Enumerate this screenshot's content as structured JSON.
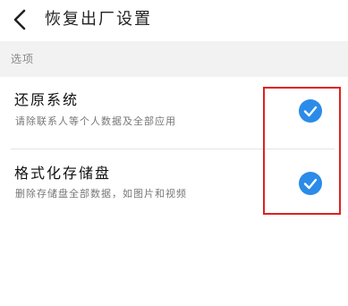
{
  "header": {
    "title": "恢复出厂设置",
    "back_icon": "chevron-left-icon"
  },
  "section": {
    "title": "选项"
  },
  "options": [
    {
      "title": "还原系统",
      "subtitle": "请除联系人等个人数据及全部应用",
      "checked": true,
      "check_icon": "checkmark-icon"
    },
    {
      "title": "格式化存储盘",
      "subtitle": "删除存储盘全部数据，如图片和视频",
      "checked": true,
      "check_icon": "checkmark-icon"
    }
  ],
  "colors": {
    "accent": "#2b8be8",
    "highlight": "#e02020",
    "section_bg": "#f2f2f2",
    "divider": "#e4e4e4"
  }
}
